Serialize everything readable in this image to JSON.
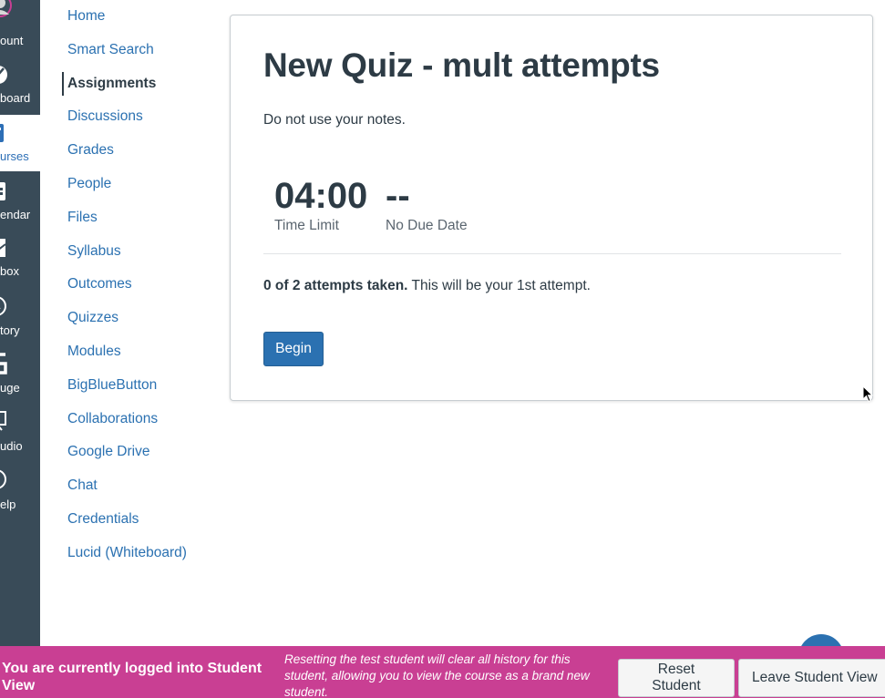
{
  "global_nav": {
    "items": [
      {
        "label": "ount",
        "icon": "account-icon"
      },
      {
        "label": "board",
        "icon": "dashboard-icon"
      },
      {
        "label": "urses",
        "icon": "courses-icon",
        "active": true
      },
      {
        "label": "endar",
        "icon": "calendar-icon"
      },
      {
        "label": "box",
        "icon": "inbox-icon"
      },
      {
        "label": "tory",
        "icon": "history-icon"
      },
      {
        "label": "uge",
        "icon": "commons-icon"
      },
      {
        "label": "udio",
        "icon": "studio-icon"
      },
      {
        "label": "elp",
        "icon": "help-icon"
      }
    ]
  },
  "course_nav": {
    "items": [
      {
        "label": "Home"
      },
      {
        "label": "Smart Search"
      },
      {
        "label": "Assignments",
        "active": true
      },
      {
        "label": "Discussions"
      },
      {
        "label": "Grades"
      },
      {
        "label": "People"
      },
      {
        "label": "Files"
      },
      {
        "label": "Syllabus"
      },
      {
        "label": "Outcomes"
      },
      {
        "label": "Quizzes"
      },
      {
        "label": "Modules"
      },
      {
        "label": "BigBlueButton"
      },
      {
        "label": "Collaborations"
      },
      {
        "label": "Google Drive"
      },
      {
        "label": "Chat"
      },
      {
        "label": "Credentials"
      },
      {
        "label": "Lucid (Whiteboard)"
      }
    ]
  },
  "quiz": {
    "title": "New Quiz - mult attempts",
    "description": "Do not use your notes.",
    "time_limit_value": "04:00",
    "time_limit_label": "Time Limit",
    "due_value": "--",
    "due_label": "No Due Date",
    "attempts_bold": "0 of 2 attempts taken.",
    "attempts_rest": " This will be your 1st attempt.",
    "begin_label": "Begin"
  },
  "student_view": {
    "message": "You are currently logged into Student View",
    "note": "Resetting the test student will clear all history for this student, allowing you to view the course as a brand new student.",
    "reset_label": "Reset Student",
    "leave_label": "Leave Student View"
  },
  "colors": {
    "nav_bg": "#394b58",
    "link": "#2b71b1",
    "student_bar": "#c93f93"
  }
}
